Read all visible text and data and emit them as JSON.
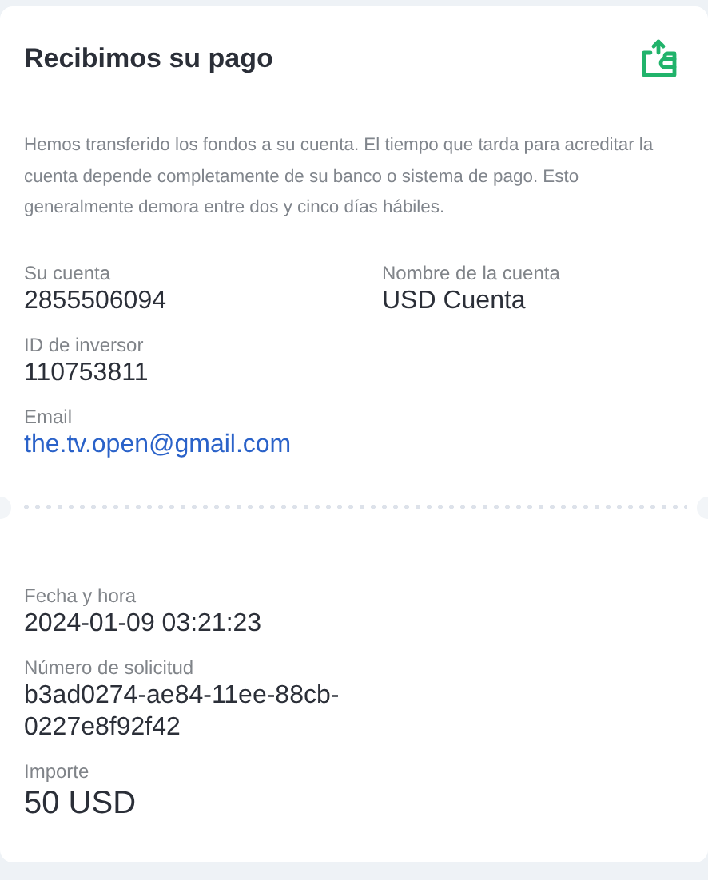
{
  "title": "Recibimos su pago",
  "description": "Hemos transferido los fondos a su cuenta. El tiempo que tarda para acreditar la cuenta depende completamente de su banco o sistema de pago. Esto generalmente demora entre dos y cinco días hábiles.",
  "account_fields": [
    {
      "label": "Su cuenta",
      "value": "2855506094",
      "kind": "text"
    },
    {
      "label": "Nombre de la cuenta",
      "value": "USD Cuenta",
      "kind": "text"
    },
    {
      "label": "ID de inversor",
      "value": "110753811",
      "kind": "text"
    },
    {
      "label": "Email",
      "value": "the.tv.open@gmail.com",
      "kind": "link"
    }
  ],
  "request_fields": [
    {
      "label": "Fecha y hora",
      "value": "2024-01-09 03:21:23",
      "kind": "text"
    },
    {
      "label": "Número de solicitud",
      "value": "b3ad0274-ae84-11ee-88cb-0227e8f92f42",
      "kind": "text"
    },
    {
      "label": "Importe",
      "value": "50 USD",
      "kind": "large"
    }
  ]
}
